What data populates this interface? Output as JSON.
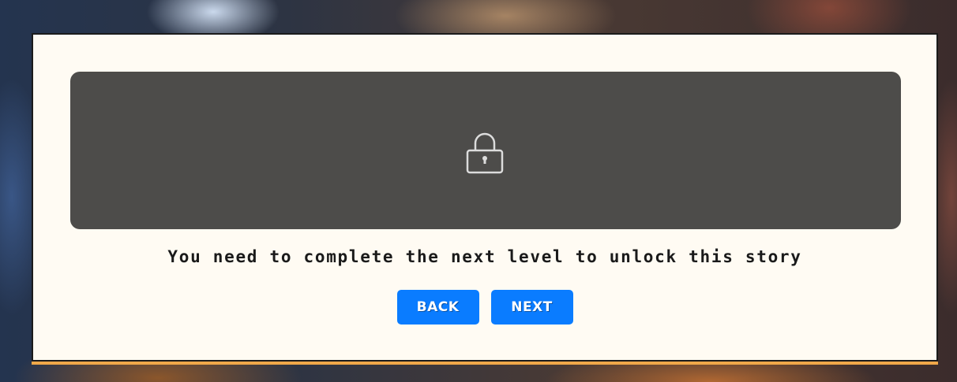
{
  "dialog": {
    "message": "You need to complete the next level to unlock this story",
    "icon": "lock-icon",
    "back_label": "BACK",
    "next_label": "NEXT"
  },
  "colors": {
    "panel": "#4d4c4a",
    "dialog_bg": "#fffbf3",
    "button": "#0a7cff",
    "accent_border": "#f0a849"
  }
}
